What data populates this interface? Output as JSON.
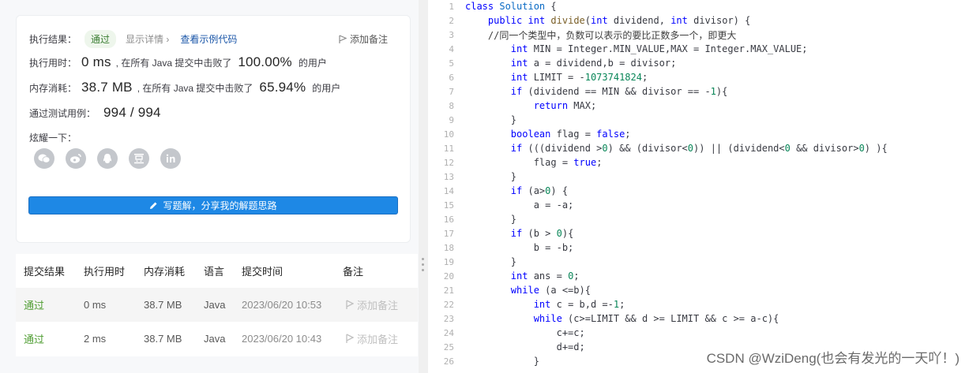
{
  "result": {
    "exec_result_label": "执行结果：",
    "status": "通过",
    "show_detail": "显示详情",
    "view_sample": "查看示例代码",
    "add_note": "添加备注",
    "time_label": "执行用时：",
    "time_value": "0 ms",
    "time_beat_text": ", 在所有 Java 提交中击败了",
    "time_percent": "100.00%",
    "time_suffix": "的用户",
    "mem_label": "内存消耗：",
    "mem_value": "38.7 MB",
    "mem_beat_text": ", 在所有 Java 提交中击败了",
    "mem_percent": "65.94%",
    "mem_suffix": "的用户",
    "tests_label": "通过测试用例：",
    "tests_value": "994 / 994",
    "share_label": "炫耀一下：",
    "share_icons": [
      "wechat-icon",
      "weibo-icon",
      "qq-icon",
      "douban-icon",
      "linkedin-icon"
    ],
    "write_button": "写题解，分享我的解题思路"
  },
  "history": {
    "headers": [
      "提交结果",
      "执行用时",
      "内存消耗",
      "语言",
      "提交时间",
      "备注"
    ],
    "rows": [
      {
        "status": "通过",
        "time": "0 ms",
        "memory": "38.7 MB",
        "lang": "Java",
        "date": "2023/06/20 10:53",
        "note": "添加备注"
      },
      {
        "status": "通过",
        "time": "2 ms",
        "memory": "38.7 MB",
        "lang": "Java",
        "date": "2023/06/20 10:43",
        "note": "添加备注"
      }
    ]
  },
  "code": {
    "lines": [
      "class Solution {",
      "    public int divide(int dividend, int divisor) {",
      "    //同一个类型中，负数可以表示的要比正数多一个，即更大",
      "        int MIN = Integer.MIN_VALUE,MAX = Integer.MAX_VALUE;",
      "        int a = dividend,b = divisor;",
      "        int LIMIT = -1073741824;",
      "        if (dividend == MIN && divisor == -1){",
      "            return MAX;",
      "        }",
      "        boolean flag = false;",
      "        if (((dividend >0) && (divisor<0)) || (dividend<0 && divisor>0) ){",
      "            flag = true;",
      "        }",
      "        if (a>0) {",
      "            a = -a;",
      "        }",
      "        if (b > 0){",
      "            b = -b;",
      "        }",
      "        int ans = 0;",
      "        while (a <=b){",
      "            int c = b,d =-1;",
      "            while (c>=LIMIT && d >= LIMIT && c >= a-c){",
      "                c+=c;",
      "                d+=d;",
      "            }"
    ]
  },
  "watermark": "CSDN @WziDeng(也会有发光的一天吖！)",
  "colors": {
    "accent": "#1e88e5",
    "success": "#4f9d32",
    "keyword": "#0000ff"
  }
}
